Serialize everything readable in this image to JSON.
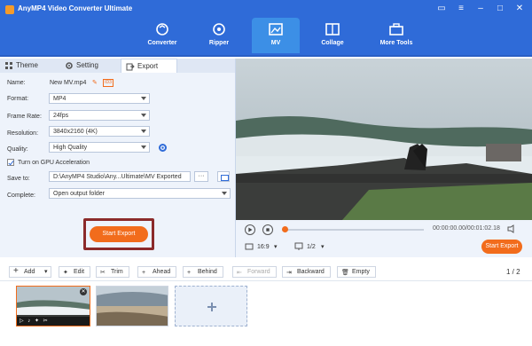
{
  "app": {
    "title": "AnyMP4 Video Converter Ultimate",
    "window_controls": [
      "feedback",
      "menu",
      "minimize",
      "maximize",
      "close"
    ]
  },
  "nav": {
    "tabs": [
      {
        "label": "Converter",
        "icon": "converter-icon"
      },
      {
        "label": "Ripper",
        "icon": "ripper-icon"
      },
      {
        "label": "MV",
        "icon": "mv-icon",
        "active": true
      },
      {
        "label": "Collage",
        "icon": "collage-icon"
      },
      {
        "label": "More Tools",
        "icon": "toolbox-icon"
      }
    ]
  },
  "left_panel": {
    "subtabs": [
      {
        "label": "Theme",
        "icon": "grid-icon"
      },
      {
        "label": "Setting",
        "icon": "gear-icon"
      },
      {
        "label": "Export",
        "icon": "export-icon",
        "active": true
      }
    ],
    "name_label": "Name:",
    "name_value": "New MV.mp4",
    "format_label": "Format:",
    "format_value": "MP4",
    "frame_rate_label": "Frame Rate:",
    "frame_rate_value": "24fps",
    "resolution_label": "Resolution:",
    "resolution_value": "3840x2160 (4K)",
    "quality_label": "Quality:",
    "quality_value": "High Quality",
    "gpu_label": "Turn on GPU Acceleration",
    "save_to_label": "Save to:",
    "save_to_value": "D:\\AnyMP4 Studio\\Any...Ultimate\\MV Exported",
    "dots_label": "···",
    "complete_label": "Complete:",
    "complete_value": "Open output folder",
    "start_export_label": "Start Export"
  },
  "player": {
    "time": "00:00:00.00/00:01:02.18",
    "aspect": "16:9",
    "zoom": "1/2",
    "start_export_label": "Start Export",
    "progress_percent": 0
  },
  "toolbar": {
    "add": "Add",
    "edit": "Edit",
    "trim": "Trim",
    "ahead": "Ahead",
    "behind": "Behind",
    "forward": "Forward",
    "backward": "Backward",
    "empty": "Empty",
    "page": "1 / 2"
  },
  "colors": {
    "header_blue": "#2f6bd8",
    "active_tab": "#3c8fe6",
    "accent_orange": "#f26c1c",
    "panel_bg": "#eef3fb",
    "highlight_border": "#8b2a2a"
  }
}
